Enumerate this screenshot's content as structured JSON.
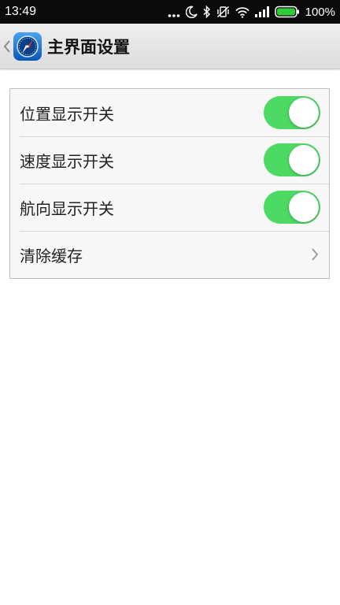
{
  "status_bar": {
    "time": "13:49",
    "battery_percent": "100%",
    "icons": [
      "more-dots-icon",
      "moon-icon",
      "bluetooth-icon",
      "vibrate-off-icon",
      "wifi-icon",
      "signal-icon",
      "battery-icon"
    ],
    "battery_level": 1.0,
    "battery_color": "#2ecc3a"
  },
  "header": {
    "back_icon": "chevron-left-icon",
    "logo_icon": "compass-icon",
    "title": "主界面设置"
  },
  "settings": {
    "items": [
      {
        "label": "位置显示开关",
        "type": "toggle",
        "on": true
      },
      {
        "label": "速度显示开关",
        "type": "toggle",
        "on": true
      },
      {
        "label": "航向显示开关",
        "type": "toggle",
        "on": true
      },
      {
        "label": "清除缓存",
        "type": "link",
        "icon": "chevron-right-icon"
      }
    ]
  },
  "colors": {
    "toggle_on": "#4cd964",
    "status_bar_bg": "#0b0b0b",
    "title_bar_bg": "#e6e6e6",
    "card_bg": "#f7f7f7"
  }
}
